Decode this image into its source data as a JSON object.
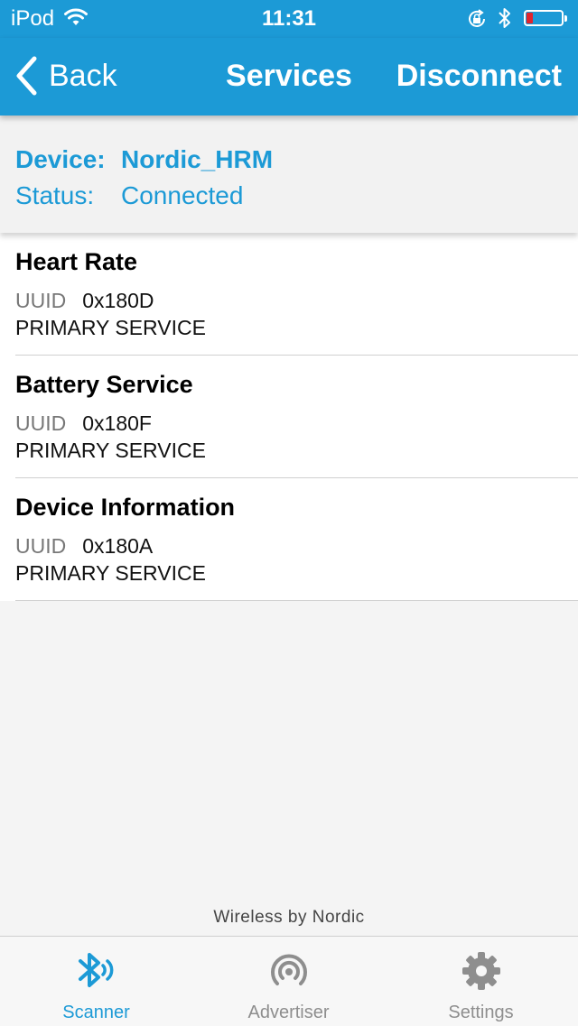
{
  "status_bar": {
    "carrier": "iPod",
    "time": "11:31",
    "battery_level_percent": 10,
    "battery_color": "#e0242e"
  },
  "nav": {
    "back_label": "Back",
    "title": "Services",
    "action_label": "Disconnect",
    "color": "#1c9ad6"
  },
  "device": {
    "device_label": "Device:",
    "device_name": "Nordic_HRM",
    "status_label": "Status:",
    "status_value": "Connected"
  },
  "services": [
    {
      "name": "Heart Rate",
      "uuid_label": "UUID",
      "uuid": "0x180D",
      "type": "PRIMARY SERVICE"
    },
    {
      "name": "Battery Service",
      "uuid_label": "UUID",
      "uuid": "0x180F",
      "type": "PRIMARY SERVICE"
    },
    {
      "name": "Device Information",
      "uuid_label": "UUID",
      "uuid": "0x180A",
      "type": "PRIMARY SERVICE"
    }
  ],
  "footer": {
    "brand": "Wireless by Nordic"
  },
  "tabs": [
    {
      "label": "Scanner",
      "icon": "bluetooth-scan-icon",
      "active": true
    },
    {
      "label": "Advertiser",
      "icon": "broadcast-icon",
      "active": false
    },
    {
      "label": "Settings",
      "icon": "gear-icon",
      "active": false
    }
  ]
}
